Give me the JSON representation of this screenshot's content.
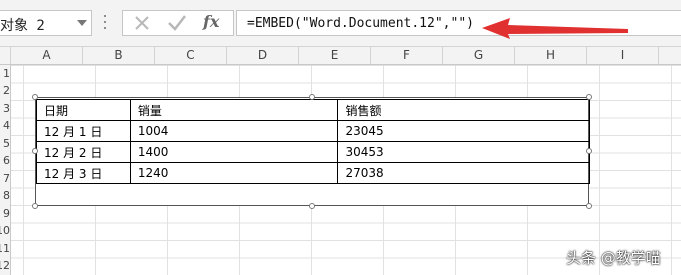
{
  "name_box": {
    "value": "对象 2"
  },
  "formula_bar": {
    "cancel_icon": "x-icon",
    "enter_icon": "check-icon",
    "function_label": "fx",
    "formula": "=EMBED(\"Word.Document.12\",\"\")"
  },
  "columns": [
    "A",
    "B",
    "C",
    "D",
    "E",
    "F",
    "G",
    "H",
    "I"
  ],
  "rows": [
    "1",
    "2",
    "3",
    "4",
    "5",
    "6",
    "7",
    "8",
    "9",
    "10",
    "11",
    "12"
  ],
  "embedded_table": {
    "headers": [
      "日期",
      "销量",
      "",
      "销售额"
    ],
    "rows": [
      [
        "12 月 1 日",
        "1004",
        "",
        "23045"
      ],
      [
        "12 月 2 日",
        "1400",
        "",
        "30453"
      ],
      [
        "12 月 3 日",
        "1240",
        "",
        "27038"
      ],
      [
        "",
        "",
        "",
        ""
      ]
    ]
  },
  "annotation": {
    "color": "#e03030"
  },
  "watermark": "头条 @教学喵"
}
